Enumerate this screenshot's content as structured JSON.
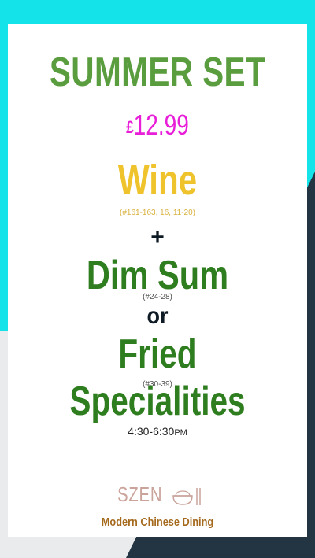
{
  "title": "SUMMER SET",
  "price": {
    "currency": "£",
    "amount": "12.99"
  },
  "wine": {
    "label": "Wine",
    "range": "(#161-163, 16, 11-20)"
  },
  "plus": "+",
  "dim_sum": {
    "label": "Dim Sum",
    "range": "(#24-28)"
  },
  "or": "or",
  "fried": {
    "label": "Fried Specialities",
    "range": "(#30-39)"
  },
  "time": {
    "hours": "4:30-6:30",
    "suffix": "PM"
  },
  "brand": {
    "name": "SZEN",
    "tagline": "Modern Chinese Dining",
    "icon": "rice-bowl-chopsticks-icon"
  },
  "colors": {
    "background_cyan": "#14e4e9",
    "background_navy": "#233543",
    "background_light": "#e9ebed",
    "title_green": "#5a9d3f",
    "price_magenta": "#e81ed9",
    "wine_gold": "#efc32c",
    "dish_green": "#2e7d1f",
    "logo_pink": "#caa39b",
    "tagline_brown": "#a56a1e"
  }
}
